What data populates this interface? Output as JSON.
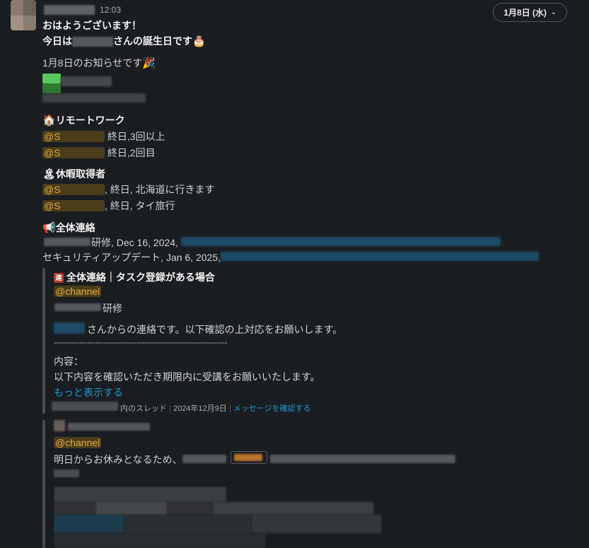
{
  "header": {
    "time": "12:03",
    "date_pill": "1月8日 (水)"
  },
  "message": {
    "greeting": "おはようございます！",
    "birthday_prefix": "今日は",
    "birthday_suffix": "さんの誕生日です",
    "notice": "1月8日のお知らせです",
    "remote_title": "リモートワーク",
    "remote_items": [
      "終日,3回以上",
      "終日,2回目"
    ],
    "vacation_title": "休暇取得者",
    "vacation_items": [
      ", 終日, 北海道に行きます",
      ", 終日, タイ旅行"
    ],
    "general_title": "全体連絡",
    "general_item1": "研修, Dec 16, 2024,",
    "general_item2": "セキュリティアップデート, Jan 6, 2025,",
    "mention_prefix": "@S"
  },
  "quote1": {
    "title": "全体連絡｜タスク登録がある場合",
    "channel": "@channel",
    "training": "研修",
    "contact_text": "さんからの連絡です。以下確認の上対応をお願いします。",
    "divider": "-------------------------------------------------------------------",
    "content_label": "内容：",
    "content_text": "以下内容を確認いただき期限内に受講をお願いいたします。",
    "show_more": "もっと表示する",
    "meta_thread": "内のスレッド",
    "meta_date": "2024年12月9日",
    "meta_link": "メッセージを確認する"
  },
  "quote2": {
    "channel": "@channel",
    "text": "明日からお休みとなるため、"
  },
  "colors": {
    "background": "#1a1d21",
    "text": "#d1d2d3",
    "mention": "#e8a73a",
    "link": "#1d9bd1"
  }
}
